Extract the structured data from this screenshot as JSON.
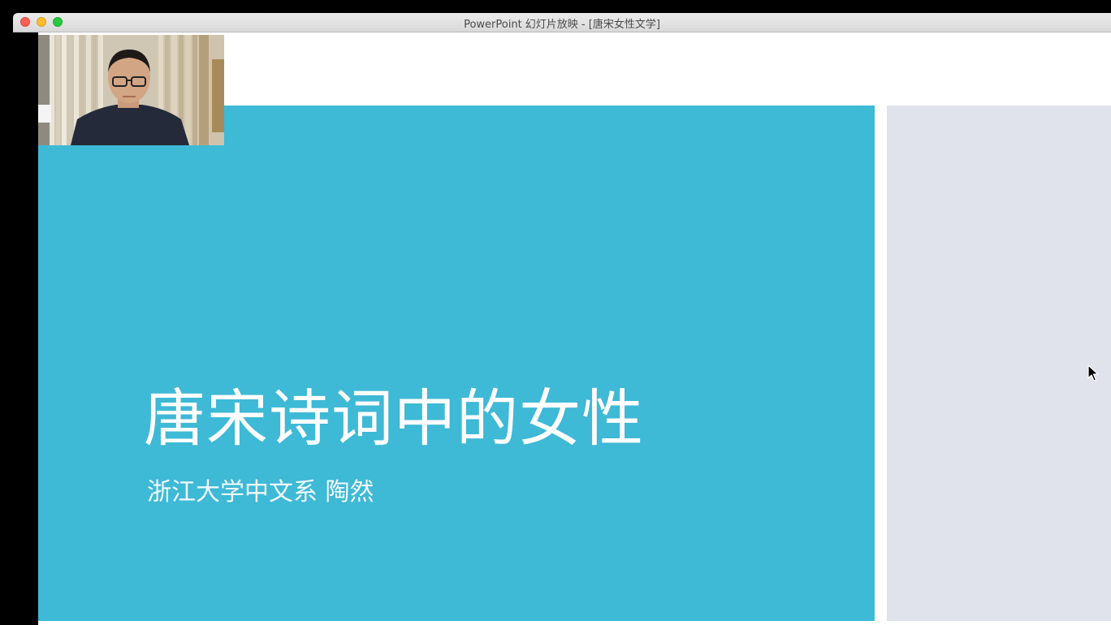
{
  "window": {
    "title": "PowerPoint 幻灯片放映 - [唐宋女性文学]"
  },
  "slide": {
    "title": "唐宋诗词中的女性",
    "subtitle": "浙江大学中文系  陶然",
    "background_color": "#3eb9d6",
    "text_color": "#ffffff"
  },
  "side_panel": {
    "color": "#e0e2ec"
  },
  "webcam": {
    "icon": "presenter-video"
  },
  "cursor": {
    "icon": "arrow-pointer"
  }
}
